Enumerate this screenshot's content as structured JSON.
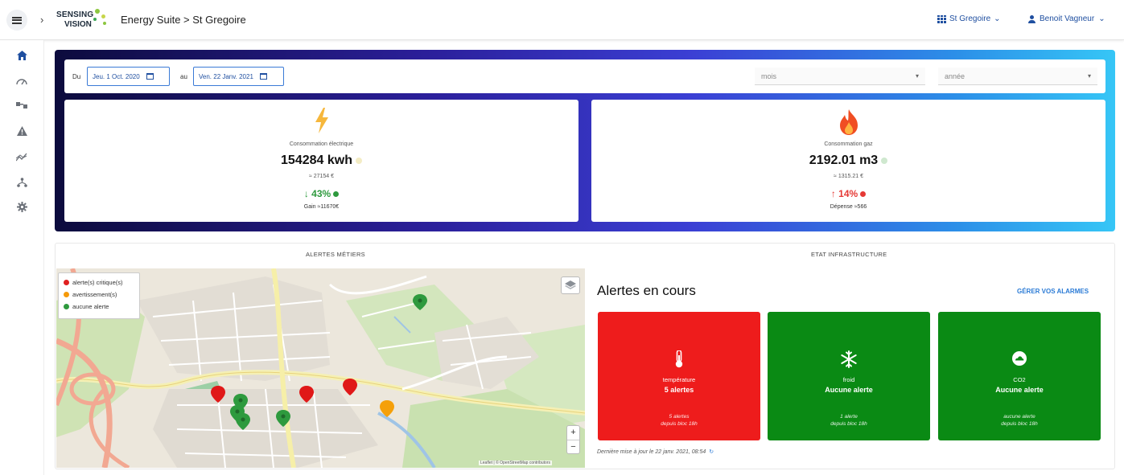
{
  "header": {
    "logo_line1": "SENSING",
    "logo_line2": "VISION",
    "breadcrumb": "Energy Suite > St Gregoire",
    "site_selector": "St Gregoire",
    "user_name": "Benoit Vagneur"
  },
  "leftnav": {
    "items": [
      "home-icon",
      "gauge-icon",
      "meters-icon",
      "warning-icon",
      "trend-icon",
      "hierarchy-icon",
      "settings-icon"
    ],
    "active_color": "#1f4fa0"
  },
  "filters": {
    "from_label": "Du",
    "from_date": "Jeu. 1 Oct. 2020",
    "to_label": "au",
    "to_date": "Ven. 22 Janv. 2021",
    "period_select": "mois",
    "year_select": "année"
  },
  "cards": {
    "electric": {
      "label": "Consommation électrique",
      "value": "154284 kwh",
      "cost": "≈ 27154 €",
      "pct": "↓ 43%",
      "pct_color": "#2e9a3e",
      "gain": "Gain ≈11670€"
    },
    "gas": {
      "label": "Consommation gaz",
      "value": "2192.01 m3",
      "cost": "≈ 1315.21 €",
      "pct": "↑ 14%",
      "pct_color": "#e53935",
      "gain": "Dépense ≈566"
    }
  },
  "tabs": {
    "left": "ALERTES MÉTIERS",
    "right": "ETAT INFRASTRUCTURE"
  },
  "map": {
    "legend": [
      {
        "label": "alerte(s) critique(s)",
        "color": "#e02020"
      },
      {
        "label": "avertissement(s)",
        "color": "#f59a0a"
      },
      {
        "label": "aucune alerte",
        "color": "#2e9a3e"
      }
    ],
    "zoom_in": "+",
    "zoom_out": "−",
    "attribution": "Leaflet | © OpenStreetMap contributors"
  },
  "alerts": {
    "title": "Alertes en cours",
    "manage_link": "GÉRER VOS ALARMES",
    "cards": [
      {
        "name": "température",
        "status": "5 alertes",
        "sub1": "5 alertes",
        "sub2": "depuis bloc 18h",
        "color": "#ee1c1c",
        "icon": "thermometer-icon"
      },
      {
        "name": "froid",
        "status": "Aucune alerte",
        "sub1": "1 alerte",
        "sub2": "depuis bloc 18h",
        "color": "#0a8a14",
        "icon": "snowflake-icon"
      },
      {
        "name": "CO2",
        "status": "Aucune alerte",
        "sub1": "aucune alerte",
        "sub2": "depuis bloc 18h",
        "color": "#0a8a14",
        "icon": "cloud-icon"
      }
    ],
    "last_update": "Dernière mise à jour le 22 janv. 2021, 08:54"
  }
}
